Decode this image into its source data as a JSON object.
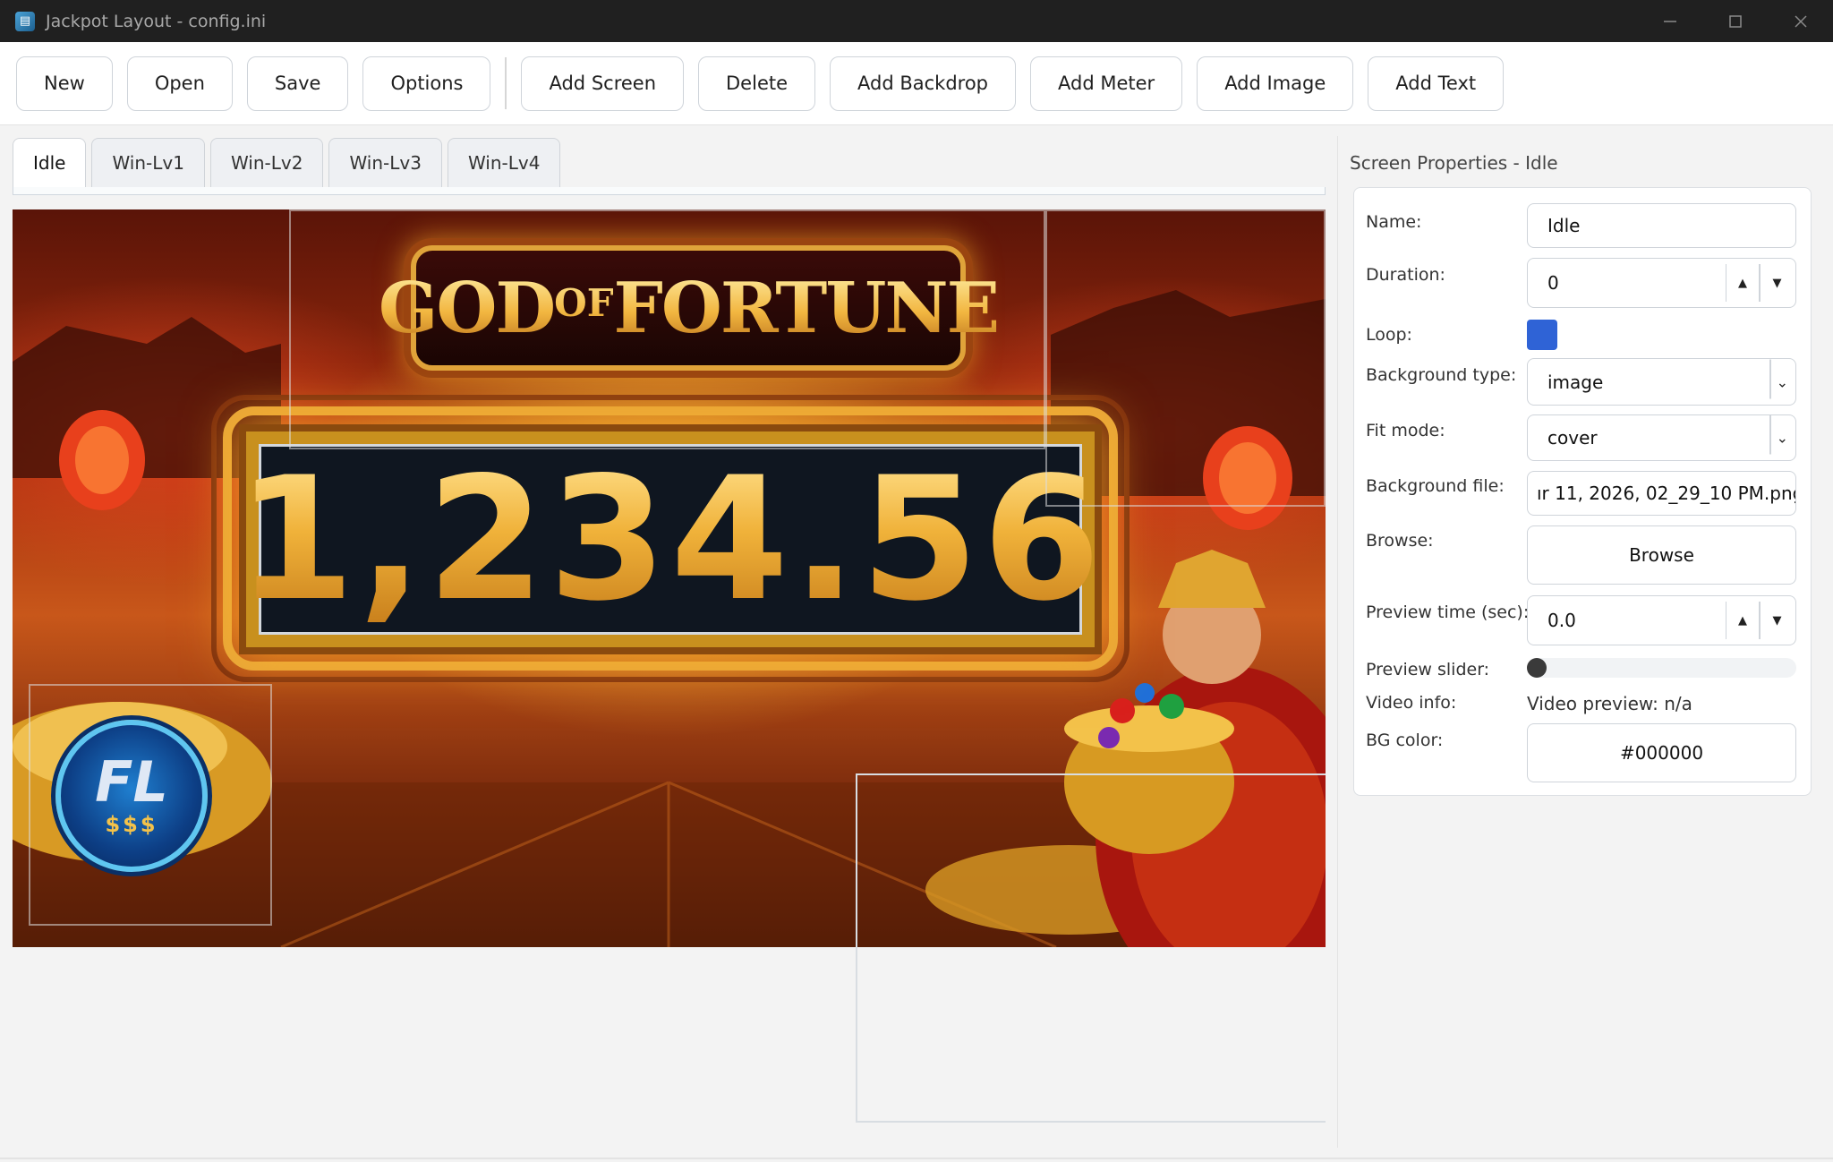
{
  "window": {
    "title": "Jackpot Layout - config.ini",
    "app_icon": "app-logo-icon"
  },
  "toolbar": {
    "file_buttons": [
      "New",
      "Open",
      "Save",
      "Options"
    ],
    "edit_buttons": [
      "Add Screen",
      "Delete",
      "Add Backdrop",
      "Add Meter",
      "Add Image",
      "Add Text"
    ]
  },
  "tabs": [
    {
      "label": "Idle",
      "active": true
    },
    {
      "label": "Win-Lv1",
      "active": false
    },
    {
      "label": "Win-Lv2",
      "active": false
    },
    {
      "label": "Win-Lv3",
      "active": false
    },
    {
      "label": "Win-Lv4",
      "active": false
    }
  ],
  "canvas": {
    "title_word_1": "GOD",
    "title_word_2": "OF",
    "title_word_3": "FORTUNE",
    "meter_value": "1,234.56",
    "logo_mark": "FL",
    "logo_sub": "$$$"
  },
  "properties": {
    "group_title": "Screen Properties - Idle",
    "name_label": "Name:",
    "name_value": "Idle",
    "duration_label": "Duration:",
    "duration_value": "0",
    "loop_label": "Loop:",
    "loop_checked": true,
    "bg_type_label": "Background type:",
    "bg_type_value": "image",
    "fit_mode_label": "Fit mode:",
    "fit_mode_value": "cover",
    "bg_file_label": "Background file:",
    "bg_file_value": "ır 11, 2026, 02_29_10 PM.png",
    "browse_label": "Browse:",
    "browse_button": "Browse",
    "preview_time_label": "Preview time (sec):",
    "preview_time_value": "0.0",
    "preview_slider_label": "Preview slider:",
    "preview_slider_value": 0,
    "video_info_label": "Video info:",
    "video_info_value": "Video preview: n/a",
    "bg_color_label": "BG color:",
    "bg_color_value": "#000000"
  },
  "colors": {
    "accent": "#2f63d6",
    "titlebar": "#202020"
  }
}
